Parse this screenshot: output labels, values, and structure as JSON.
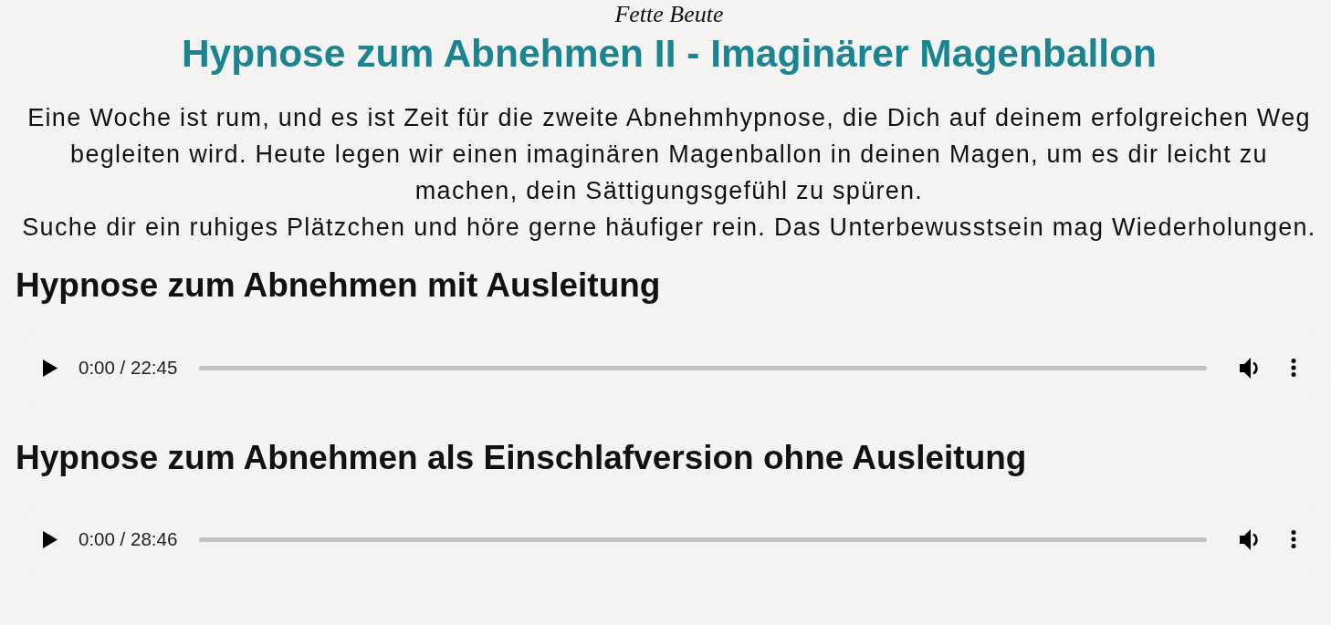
{
  "site_title": "Fette Beute",
  "title": "Hypnose zum Abnehmen II - Imaginärer Magenballon",
  "intro": [
    "Eine Woche ist rum, und es ist Zeit für die zweite Abnehmhypnose, die Dich auf deinem erfolgreichen Weg begleiten wird. Heute legen wir einen imaginären Magenballon in deinen Magen, um es dir leicht zu machen, dein Sättigungsgefühl zu spüren.",
    "Suche dir ein ruhiges Plätzchen und höre gerne häufiger rein. Das Unterbewusstsein mag Wiederholungen."
  ],
  "tracks": [
    {
      "heading": "Hypnose zum Abnehmen mit Ausleitung",
      "player": {
        "time": "0:00 / 22:45",
        "level": 0
      }
    },
    {
      "heading": "Hypnose zum Abnehmen als Einschlafversion ohne Ausleitung",
      "player": {
        "time": "0:00 / 28:46",
        "level": 0
      }
    }
  ]
}
